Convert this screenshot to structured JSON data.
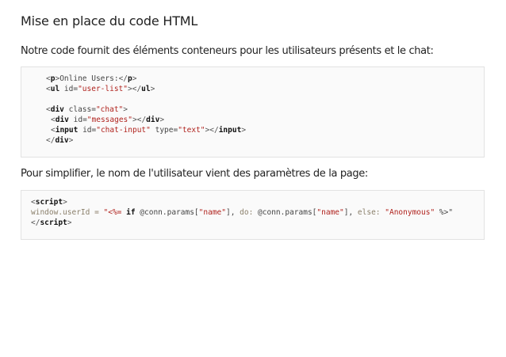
{
  "title": "Mise en place du code HTML",
  "paragraph1": "Notre code fournit des éléments conteneurs pour les utilisateurs présents et le chat:",
  "paragraph2": "Pour simplifier, le nom de l'utilisateur vient des paramètres de la page:",
  "code1": {
    "line1": {
      "open": "<",
      "tag": "p",
      "close": ">",
      "text": "Online Users:",
      "end_open": "</",
      "end_tag": "p",
      "end_close": ">"
    },
    "line2": {
      "open": "<",
      "tag": "ul",
      "attr": " id=",
      "val": "\"user-list\"",
      "mid": "></",
      "end_tag": "ul",
      "end_close": ">"
    },
    "line4": {
      "open": "<",
      "tag": "div",
      "attr": " class=",
      "val": "\"chat\"",
      "close": ">"
    },
    "line5": {
      "open": "<",
      "tag": "div",
      "attr": " id=",
      "val": "\"messages\"",
      "mid": "></",
      "end_tag": "div",
      "end_close": ">"
    },
    "line6": {
      "open": "<",
      "tag": "input",
      "attr1": " id=",
      "val1": "\"chat-input\"",
      "attr2": " type=",
      "val2": "\"text\"",
      "mid": "></",
      "end_tag": "input",
      "end_close": ">"
    },
    "line7": {
      "open": "</",
      "tag": "div",
      "close": ">"
    }
  },
  "code2": {
    "line1": {
      "open": "<",
      "tag": "script",
      "close": ">"
    },
    "line2": {
      "lhs": "window.userId = ",
      "q1": "\"<%= ",
      "kw_if": "if",
      "p1": " @conn.params[",
      "s1": "\"name\"",
      "p2": "], ",
      "do": "do:",
      "p3": " @conn.params[",
      "s2": "\"name\"",
      "p4": "], ",
      "else": "else:",
      "p5": " ",
      "s3": "\"Anonymous\"",
      "p6": " %>\""
    },
    "line3": {
      "open": "</",
      "tag": "script",
      "close": ">"
    }
  }
}
